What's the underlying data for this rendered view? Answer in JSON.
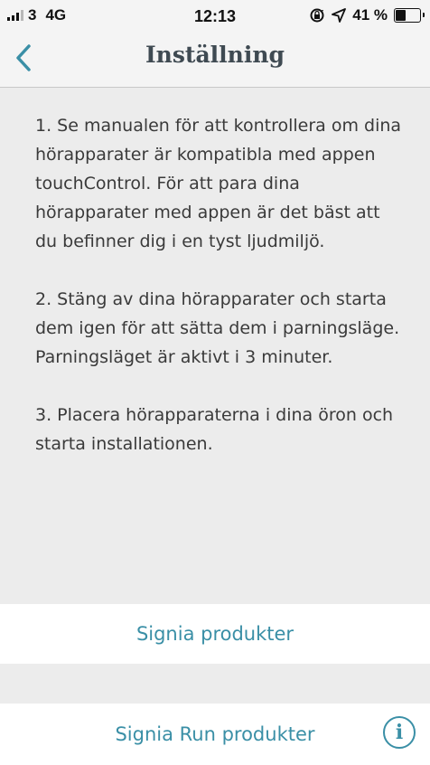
{
  "status_bar": {
    "carrier": "3",
    "network": "4G",
    "time": "12:13",
    "battery_text": "41 %",
    "battery_level": 0.41,
    "signal_bars_filled": 3,
    "icons": [
      "signal-icon",
      "lock-rotation-icon",
      "location-arrow-icon",
      "battery-icon"
    ]
  },
  "nav": {
    "title": "Inställning",
    "back_icon": "chevron-left-icon"
  },
  "instructions": [
    "1. Se manualen för att kontrollera om dina hörapparater är kompatibla med appen touchControl. För att para dina hörapparater med appen är det bäst att du befinner dig i en tyst ljudmiljö.",
    "2. Stäng av dina hörapparater och starta dem igen för att sätta dem i parningsläge. Parningsläget är aktivt i 3 minuter.",
    "3. Placera hörapparaterna i dina öron och starta installationen."
  ],
  "actions": {
    "signia_products": "Signia produkter",
    "signia_run_products": "Signia Run produkter",
    "info_icon": "info-icon",
    "info_glyph": "i"
  },
  "colors": {
    "accent": "#3a8fa6",
    "background": "#ececec",
    "nav_background": "#f4f4f4"
  }
}
